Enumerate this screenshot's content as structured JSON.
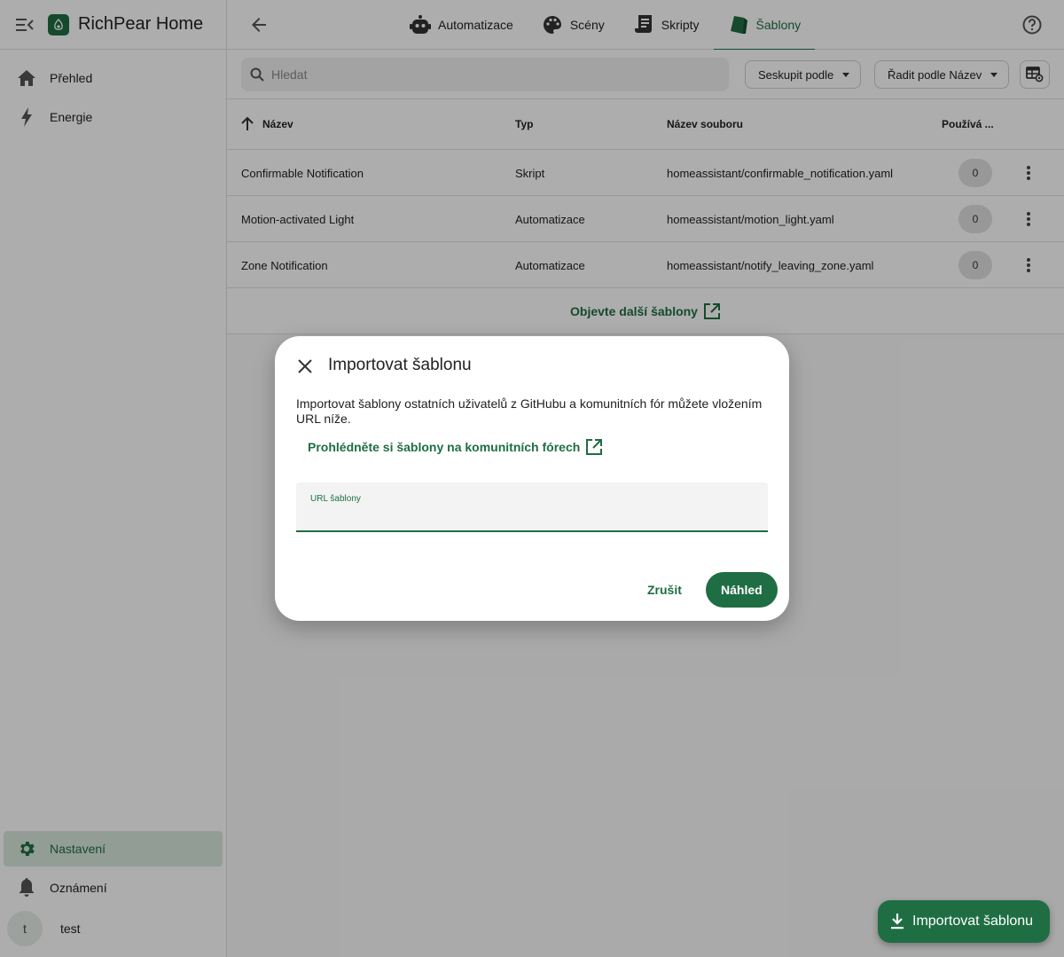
{
  "app": {
    "title": "RichPear Home"
  },
  "sidebar": {
    "items": [
      {
        "label": "Přehled",
        "icon": "home-icon"
      },
      {
        "label": "Energie",
        "icon": "lightning-icon"
      }
    ],
    "bottom_items": [
      {
        "label": "Nastavení",
        "icon": "gear-icon",
        "active": true
      },
      {
        "label": "Oznámení",
        "icon": "bell-icon"
      }
    ],
    "user": {
      "initial": "t",
      "name": "test"
    }
  },
  "tabs": [
    {
      "label": "Automatizace",
      "icon": "robot-icon"
    },
    {
      "label": "Scény",
      "icon": "palette-icon"
    },
    {
      "label": "Skripty",
      "icon": "script-icon"
    },
    {
      "label": "Šablony",
      "icon": "blueprint-icon",
      "active": true
    }
  ],
  "toolbar": {
    "search_placeholder": "Hledat",
    "group_by_label": "Seskupit podle",
    "sort_by_label": "Řadit podle Název"
  },
  "table": {
    "columns": [
      "Název",
      "Typ",
      "Název souboru",
      "Používá ..."
    ],
    "rows": [
      {
        "name": "Confirmable Notification",
        "type": "Skript",
        "file": "homeassistant/confirmable_notification.yaml",
        "used": "0"
      },
      {
        "name": "Motion-activated Light",
        "type": "Automatizace",
        "file": "homeassistant/motion_light.yaml",
        "used": "0"
      },
      {
        "name": "Zone Notification",
        "type": "Automatizace",
        "file": "homeassistant/notify_leaving_zone.yaml",
        "used": "0"
      }
    ],
    "footer_link": "Objevte další šablony"
  },
  "dialog": {
    "title": "Importovat šablonu",
    "text": "Importovat šablony ostatních uživatelů z GitHubu a komunitních fór můžete vložením URL níže.",
    "link": "Prohlédněte si šablony na komunitních fórech",
    "field_label": "URL šablony",
    "field_value": "",
    "cancel_label": "Zrušit",
    "preview_label": "Náhled"
  },
  "fab": {
    "label": "Importovat šablonu"
  },
  "colors": {
    "accent": "#1f6e43",
    "active_bg": "#d7e8dd"
  }
}
